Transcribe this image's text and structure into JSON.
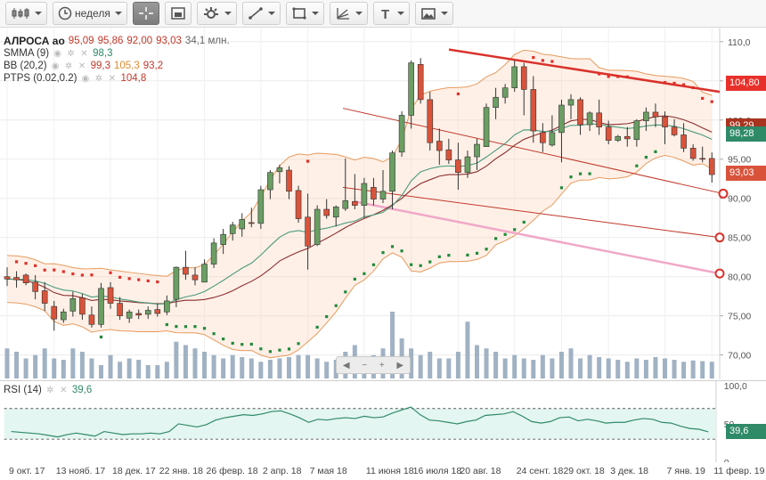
{
  "toolbar": {
    "period_label": "неделя",
    "buttons": [
      "candle-type",
      "period",
      "crosshair",
      "autoscale",
      "indicators",
      "draw-line",
      "shapes",
      "fibonacci",
      "text",
      "image"
    ]
  },
  "legend": {
    "ticker": "АЛРОСА ао",
    "open": "95,09",
    "high": "95,86",
    "low": "92,00",
    "close": "93,03",
    "volume": "34,1 млн.",
    "smma_name": "SMMA (9)",
    "smma_value": "98,3",
    "bb_name": "BB (20,2)",
    "bb_mid": "99,3",
    "bb_upper": "105,3",
    "bb_lower": "93,2",
    "ptps_name": "PTPS (0.02,0.2)",
    "ptps_value": "104,8"
  },
  "rsi_legend": {
    "name": "RSI (14)",
    "value": "39,6"
  },
  "price_tags": [
    {
      "text": "104,80",
      "color": "#e8302a"
    },
    {
      "text": "99,29",
      "color": "#a8341f"
    },
    {
      "text": "98,28",
      "color": "#2f8a68"
    },
    {
      "text": "93,03",
      "color": "#d9533b"
    }
  ],
  "rsi_tag": {
    "text": "39,6",
    "color": "#2f8a68"
  },
  "chart_data": {
    "type": "candlestick",
    "title": "АЛРОСА ао",
    "interval": "неделя",
    "y_ticks": [
      70,
      75,
      80,
      85,
      90,
      95,
      100,
      105,
      110
    ],
    "y_tick_labels": [
      "70,00",
      "75,00",
      "80,00",
      "85,00",
      "90,00",
      "95,00",
      "100,0",
      "105,0",
      "110,0"
    ],
    "ylim": [
      67,
      111
    ],
    "x_ticks": [
      "9 окт. 17",
      "13 нояб. 17",
      "18 дек. 17",
      "22 янв. 18",
      "26 февр. 18",
      "2 апр. 18",
      "7 мая 18",
      "11 июня 18",
      "16 июля 18",
      "20 авг. 18",
      "24 сент. 18",
      "29 окт. 18",
      "3 дек. 18",
      "7 янв. 19",
      "11 февр. 19"
    ],
    "candles": [
      [
        80.0,
        81.2,
        78.8,
        79.7
      ],
      [
        79.9,
        80.7,
        78.6,
        79.6
      ],
      [
        80.2,
        80.4,
        78.9,
        79.2
      ],
      [
        79.3,
        80.2,
        77.1,
        78.1
      ],
      [
        78.2,
        79.3,
        75.6,
        76.6
      ],
      [
        76.2,
        76.9,
        73.1,
        74.6
      ],
      [
        74.5,
        75.9,
        74.1,
        75.5
      ],
      [
        75.6,
        78.1,
        74.9,
        77.2
      ],
      [
        77.3,
        77.8,
        74.5,
        75.2
      ],
      [
        75.1,
        76.2,
        73.5,
        73.9
      ],
      [
        73.9,
        79.2,
        73.5,
        78.5
      ],
      [
        78.6,
        79.3,
        75.9,
        76.6
      ],
      [
        76.6,
        77.4,
        74.5,
        75.0
      ],
      [
        74.7,
        75.8,
        74.1,
        75.5
      ],
      [
        75.3,
        75.8,
        74.6,
        75.1
      ],
      [
        75.2,
        76.2,
        74.6,
        75.7
      ],
      [
        75.8,
        76.6,
        74.9,
        75.3
      ],
      [
        75.5,
        77.6,
        75.1,
        76.9
      ],
      [
        77.1,
        81.3,
        76.1,
        81.2
      ],
      [
        81.2,
        83.3,
        79.6,
        80.3
      ],
      [
        80.2,
        81.2,
        78.9,
        79.6
      ],
      [
        79.3,
        82.2,
        79.4,
        81.6
      ],
      [
        81.6,
        84.9,
        81.1,
        84.3
      ],
      [
        84.1,
        86.1,
        82.9,
        85.4
      ],
      [
        85.5,
        87.0,
        84.6,
        86.6
      ],
      [
        86.1,
        88.1,
        85.1,
        87.3
      ],
      [
        86.9,
        88.8,
        86.3,
        86.8
      ],
      [
        86.8,
        91.6,
        86.1,
        91.1
      ],
      [
        91.1,
        93.6,
        89.9,
        93.3
      ],
      [
        93.4,
        94.3,
        91.9,
        93.9
      ],
      [
        93.6,
        94.1,
        89.9,
        90.9
      ],
      [
        91.0,
        91.6,
        86.9,
        87.4
      ],
      [
        87.6,
        90.6,
        80.9,
        83.9
      ],
      [
        84.1,
        89.1,
        83.9,
        88.6
      ],
      [
        88.6,
        89.9,
        87.4,
        87.8
      ],
      [
        87.6,
        89.1,
        86.4,
        88.9
      ],
      [
        88.7,
        95.1,
        88.4,
        89.7
      ],
      [
        89.6,
        93.1,
        88.6,
        89.1
      ],
      [
        89.1,
        92.6,
        87.5,
        91.9
      ],
      [
        91.4,
        92.6,
        89.1,
        89.9
      ],
      [
        89.9,
        93.6,
        89.4,
        90.9
      ],
      [
        90.9,
        96.1,
        88.6,
        95.8
      ],
      [
        95.9,
        101.1,
        95.3,
        100.6
      ],
      [
        100.6,
        107.6,
        98.9,
        107.3
      ],
      [
        107.1,
        107.9,
        102.1,
        102.6
      ],
      [
        102.6,
        103.6,
        96.1,
        97.1
      ],
      [
        97.3,
        98.9,
        94.3,
        96.1
      ],
      [
        96.2,
        97.6,
        94.4,
        94.9
      ],
      [
        94.9,
        97.1,
        91.1,
        93.3
      ],
      [
        93.3,
        96.1,
        92.6,
        95.3
      ],
      [
        95.3,
        97.6,
        93.6,
        96.9
      ],
      [
        96.6,
        102.1,
        96.6,
        101.6
      ],
      [
        101.6,
        104.1,
        100.1,
        102.9
      ],
      [
        102.9,
        104.6,
        102.1,
        104.1
      ],
      [
        104.1,
        107.6,
        103.6,
        106.8
      ],
      [
        106.8,
        107.3,
        100.6,
        103.9
      ],
      [
        103.9,
        105.6,
        97.1,
        98.6
      ],
      [
        98.4,
        99.6,
        95.9,
        97.1
      ],
      [
        96.8,
        100.6,
        96.6,
        98.4
      ],
      [
        98.4,
        102.6,
        94.6,
        101.9
      ],
      [
        101.9,
        103.3,
        100.1,
        102.6
      ],
      [
        102.6,
        102.9,
        98.1,
        99.4
      ],
      [
        99.4,
        101.1,
        98.6,
        100.9
      ],
      [
        100.9,
        102.6,
        98.1,
        99.1
      ],
      [
        99.1,
        99.9,
        96.9,
        97.4
      ],
      [
        97.4,
        98.1,
        97.2,
        97.9
      ],
      [
        97.9,
        99.1,
        96.6,
        97.6
      ],
      [
        97.5,
        100.1,
        96.6,
        99.9
      ],
      [
        99.9,
        101.6,
        98.6,
        101.0
      ],
      [
        101.0,
        102.1,
        99.1,
        100.4
      ],
      [
        100.4,
        101.1,
        96.9,
        99.1
      ],
      [
        99.1,
        100.1,
        97.9,
        98.1
      ],
      [
        98.1,
        99.6,
        95.9,
        96.4
      ],
      [
        96.4,
        96.9,
        94.8,
        95.1
      ],
      [
        95.1,
        96.6,
        94.6,
        95.0
      ],
      [
        95.09,
        95.86,
        92.0,
        93.03
      ]
    ],
    "volume_scale": "относительный",
    "volumes": [
      0.45,
      0.4,
      0.3,
      0.35,
      0.45,
      0.3,
      0.28,
      0.45,
      0.4,
      0.3,
      0.2,
      0.35,
      0.25,
      0.3,
      0.28,
      0.2,
      0.2,
      0.25,
      0.55,
      0.5,
      0.45,
      0.4,
      0.35,
      0.3,
      0.35,
      0.32,
      0.3,
      0.25,
      0.28,
      0.3,
      0.32,
      0.35,
      0.35,
      0.3,
      0.25,
      0.28,
      0.4,
      0.5,
      0.3,
      0.35,
      0.45,
      1.0,
      0.6,
      0.45,
      0.35,
      0.4,
      0.3,
      0.3,
      0.4,
      0.85,
      0.5,
      0.45,
      0.4,
      0.3,
      0.35,
      0.3,
      0.28,
      0.35,
      0.3,
      0.4,
      0.45,
      0.3,
      0.35,
      0.32,
      0.3,
      0.28,
      0.25,
      0.3,
      0.28,
      0.32,
      0.3,
      0.28,
      0.25,
      0.27,
      0.26,
      0.25
    ],
    "rsi": {
      "name": "RSI (14)",
      "ylim": [
        0,
        100
      ],
      "y_ticks": [
        0,
        50,
        100
      ],
      "y_tick_labels": [
        "0",
        "50",
        "100,0"
      ],
      "levels": [
        30,
        70
      ],
      "values": [
        40,
        39,
        38,
        37,
        35,
        33,
        36,
        38,
        36,
        34,
        40,
        38,
        36,
        37,
        37,
        38,
        37,
        40,
        50,
        48,
        46,
        49,
        55,
        58,
        60,
        62,
        61,
        63,
        66,
        67,
        63,
        58,
        52,
        56,
        55,
        57,
        58,
        57,
        60,
        58,
        59,
        64,
        68,
        72,
        62,
        55,
        54,
        52,
        50,
        53,
        55,
        61,
        62,
        63,
        66,
        60,
        53,
        51,
        53,
        58,
        59,
        54,
        56,
        54,
        51,
        52,
        52,
        55,
        57,
        56,
        52,
        51,
        47,
        44,
        43,
        39.6
      ]
    }
  }
}
